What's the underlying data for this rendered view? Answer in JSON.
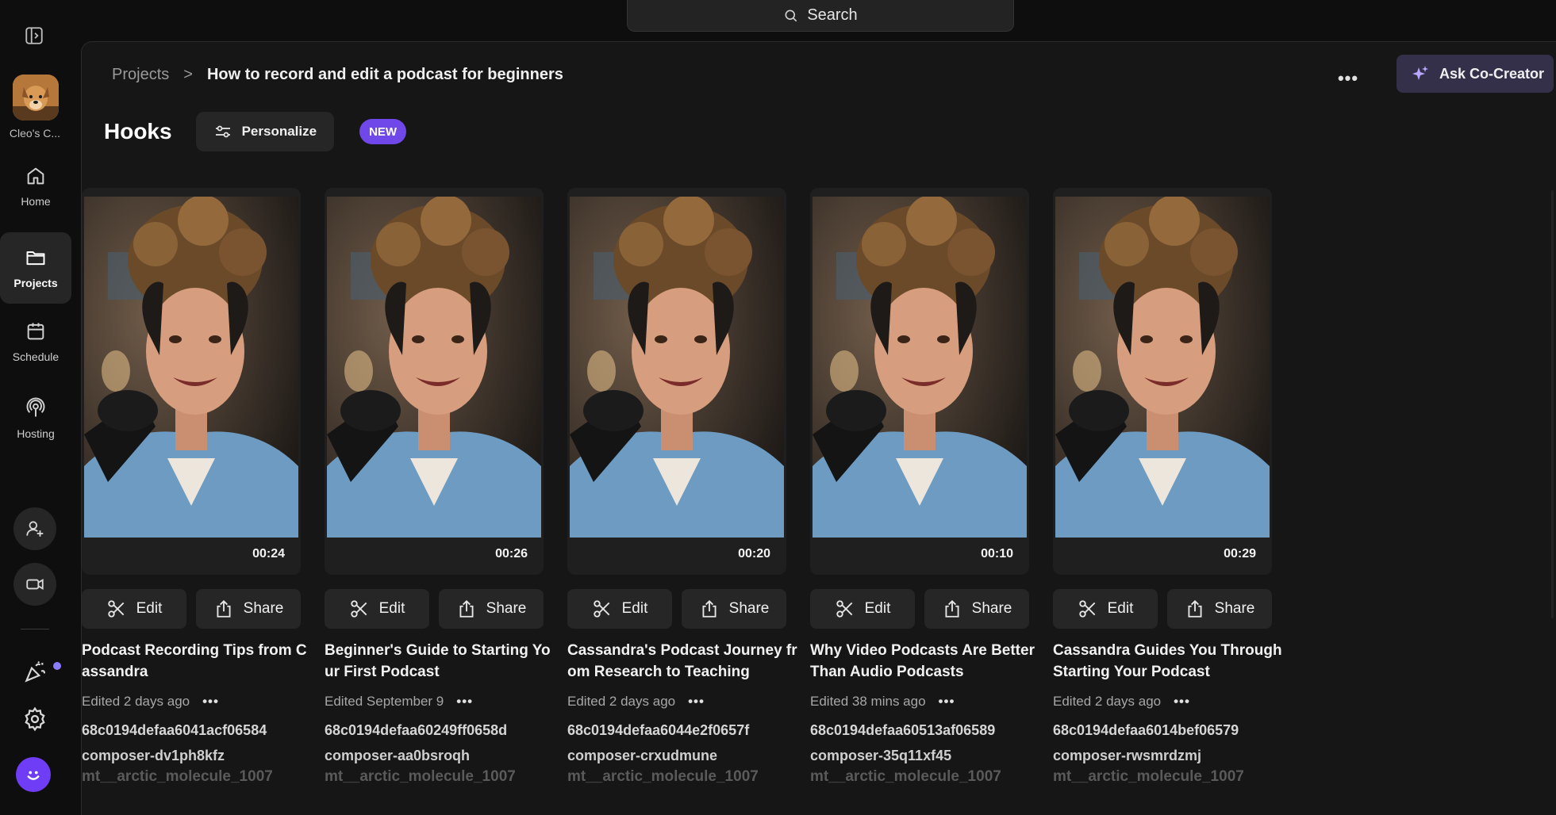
{
  "search": {
    "label": "Search"
  },
  "sidebar": {
    "workspace_label": "Cleo's C...",
    "items": [
      {
        "label": "Home",
        "icon": "home-icon"
      },
      {
        "label": "Projects",
        "icon": "folder-icon",
        "active": true
      },
      {
        "label": "Schedule",
        "icon": "calendar-icon"
      },
      {
        "label": "Hosting",
        "icon": "podcast-icon"
      }
    ]
  },
  "header": {
    "breadcrumb_root": "Projects",
    "breadcrumb_separator": ">",
    "breadcrumb_current": "How to record and edit a podcast for beginners",
    "more_label": "•••",
    "cocreator_label": "Ask Co-Creator"
  },
  "section": {
    "title": "Hooks",
    "personalize_label": "Personalize",
    "new_badge": "NEW"
  },
  "actions": {
    "edit_label": "Edit",
    "share_label": "Share",
    "more_label": "•••"
  },
  "cards": [
    {
      "duration": "00:24",
      "title": "Podcast Recording Tips from Cassandra",
      "edited": "Edited 2 days ago",
      "id": "68c0194defaa6041acf06584",
      "composer": "composer-dv1ph8kfz",
      "mt": "mt__arctic_molecule_1007"
    },
    {
      "duration": "00:26",
      "title": "Beginner's Guide to Starting Your First Podcast",
      "edited": "Edited September 9",
      "id": "68c0194defaa60249ff0658d",
      "composer": "composer-aa0bsroqh",
      "mt": "mt__arctic_molecule_1007"
    },
    {
      "duration": "00:20",
      "title": "Cassandra's Podcast Journey from Research to Teaching",
      "edited": "Edited 2 days ago",
      "id": "68c0194defaa6044e2f0657f",
      "composer": "composer-crxudmune",
      "mt": "mt__arctic_molecule_1007"
    },
    {
      "duration": "00:10",
      "title": "Why Video Podcasts Are Better Than Audio Podcasts",
      "edited": "Edited 38 mins ago",
      "id": "68c0194defaa60513af06589",
      "composer": "composer-35q11xf45",
      "mt": "mt__arctic_molecule_1007"
    },
    {
      "duration": "00:29",
      "title": "Cassandra Guides You Through Starting Your Podcast",
      "edited": "Edited 2 days ago",
      "id": "68c0194defaa6014bef06579",
      "composer": "composer-rwsmrdzmj",
      "mt": "mt__arctic_molecule_1007"
    }
  ],
  "colors": {
    "accent": "#7047e8",
    "cocreator_bg": "#34304a",
    "panel_bg": "#161616"
  }
}
